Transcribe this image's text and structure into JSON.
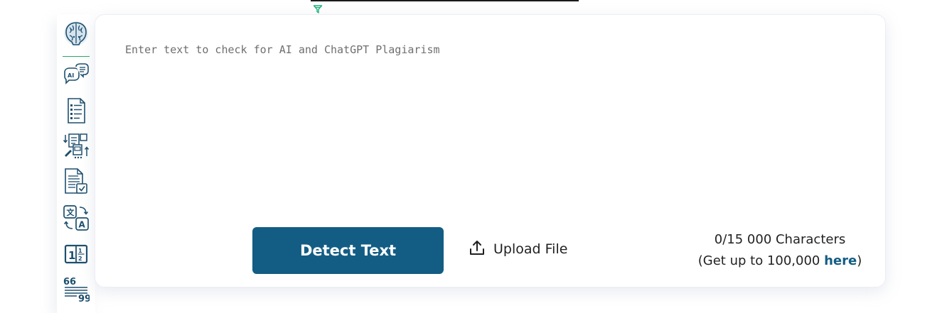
{
  "editor": {
    "placeholder": "Enter text to check for AI and ChatGPT Plagiarism",
    "value": ""
  },
  "actions": {
    "detect_label": "Detect Text",
    "upload_label": "Upload File"
  },
  "counter": {
    "count_text": "0/15 000 Characters",
    "upgrade_prefix": "(Get up to 100,000 ",
    "upgrade_link": "here",
    "upgrade_suffix": ")"
  },
  "sidebar": {
    "icons": [
      "brain-logo-icon",
      "ai-chat-icon",
      "document-list-icon",
      "document-transfer-icon",
      "document-check-icon",
      "translate-icon",
      "fraction-icon",
      "quote-icon"
    ]
  },
  "colors": {
    "primary": "#135d84",
    "icon": "#1d4f6e",
    "accent_green": "#24a86b",
    "text": "#222222"
  }
}
